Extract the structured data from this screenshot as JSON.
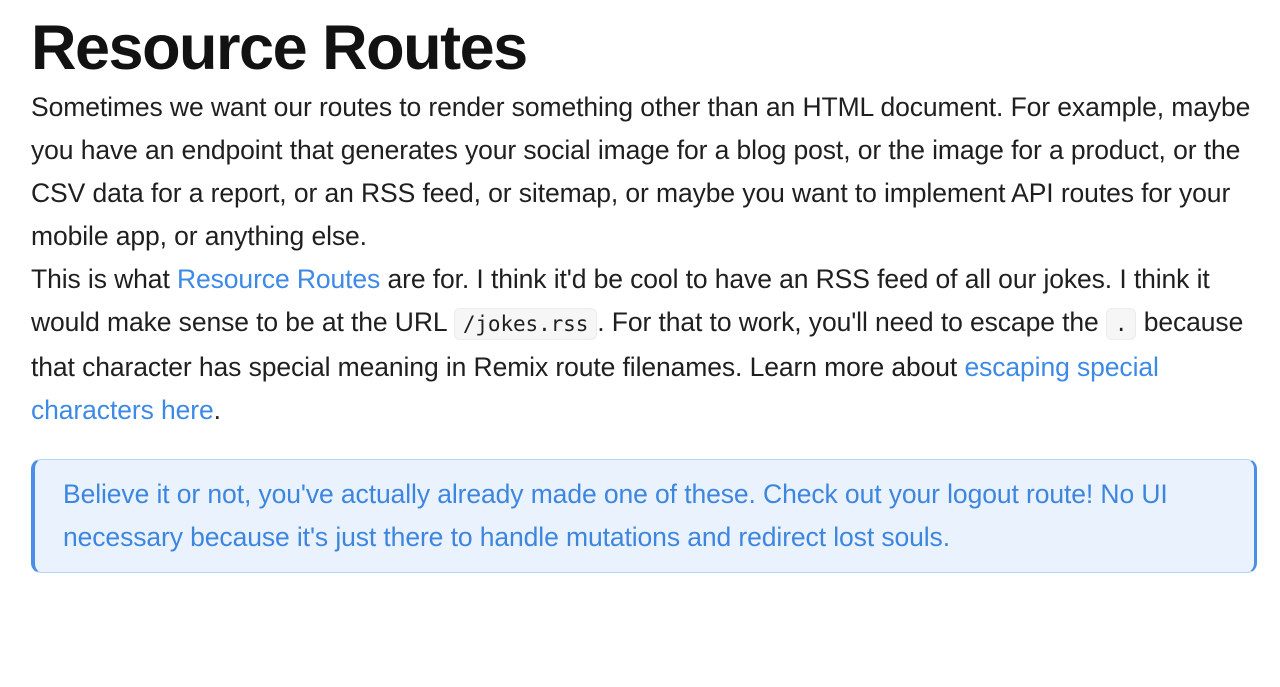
{
  "heading": "Resource Routes",
  "paragraph1": "Sometimes we want our routes to render something other than an HTML document. For example, maybe you have an endpoint that generates your social image for a blog post, or the image for a product, or the CSV data for a report, or an RSS feed, or sitemap, or maybe you want to implement API routes for your mobile app, or anything else.",
  "paragraph2": {
    "text_before_link1": "This is what ",
    "link1": "Resource Routes",
    "text_after_link1": " are for. I think it'd be cool to have an RSS feed of all our jokes. I think it would make sense to be at the URL ",
    "code1": "/jokes.rss",
    "text_after_code1": ". For that to work, you'll need to escape the ",
    "code2": ".",
    "text_after_code2": " because that character has special meaning in Remix route filenames. Learn more about ",
    "link2": "escaping special characters here",
    "text_end": "."
  },
  "callout": {
    "text": "Believe it or not, you've actually already made one of these. Check out your logout route! No UI necessary because it's just there to handle mutations and redirect lost souls."
  },
  "colors": {
    "link": "#3d8ae6",
    "callout_text": "#3d86e0",
    "callout_bg": "#eaf2fd",
    "callout_border": "#4a8fe7"
  }
}
